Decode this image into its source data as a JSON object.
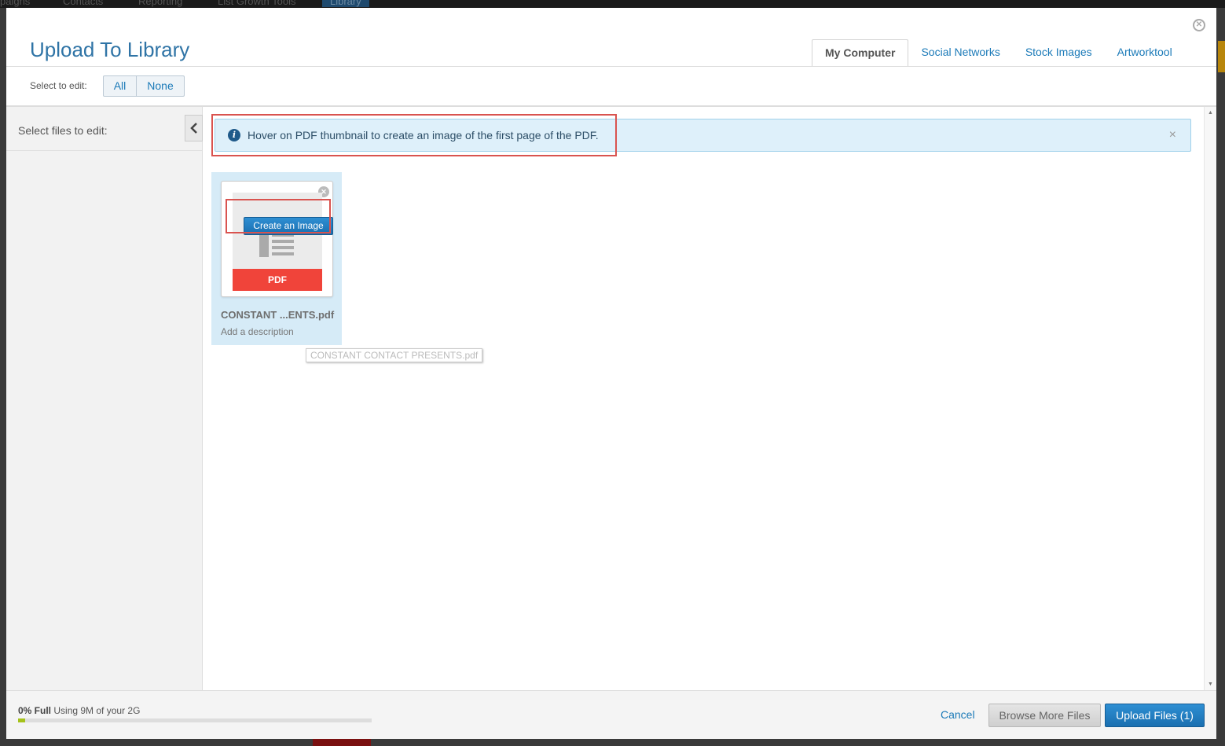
{
  "background_nav": {
    "items": [
      "paigns",
      "Contacts",
      "Reporting",
      "List Growth Tools",
      "Library"
    ]
  },
  "modal": {
    "title": "Upload To Library",
    "close_icon": "close-circle-icon"
  },
  "tabs": [
    {
      "label": "My Computer",
      "active": true
    },
    {
      "label": "Social Networks",
      "active": false
    },
    {
      "label": "Stock Images",
      "active": false
    },
    {
      "label": "Artworktool",
      "active": false
    }
  ],
  "select_to_edit": {
    "label": "Select to edit:",
    "all_label": "All",
    "none_label": "None"
  },
  "sidebar": {
    "title": "Select files to edit:",
    "collapse_icon": "chevron-left-icon"
  },
  "alert": {
    "icon": "info-icon",
    "text": "Hover on PDF thumbnail to create an image of the first page of the PDF.",
    "close_glyph": "×"
  },
  "file": {
    "name": "CONSTANT ...ENTS.pdf",
    "full_name": "CONSTANT CONTACT PRESENTS.pdf",
    "description_placeholder": "Add a description",
    "type_label": "PDF",
    "create_image_label": "Create an Image"
  },
  "footer": {
    "usage_percent_label": "0% Full",
    "usage_text": "Using 9M of your 2G",
    "usage_fraction": 0.02,
    "cancel_label": "Cancel",
    "browse_label": "Browse More Files",
    "upload_label": "Upload Files (1)"
  },
  "colors": {
    "accent": "#1b7ab8",
    "title": "#2f74a6",
    "pdf_red": "#f0443a",
    "highlight": "#d9534f",
    "usage_fill": "#a5c21a"
  }
}
